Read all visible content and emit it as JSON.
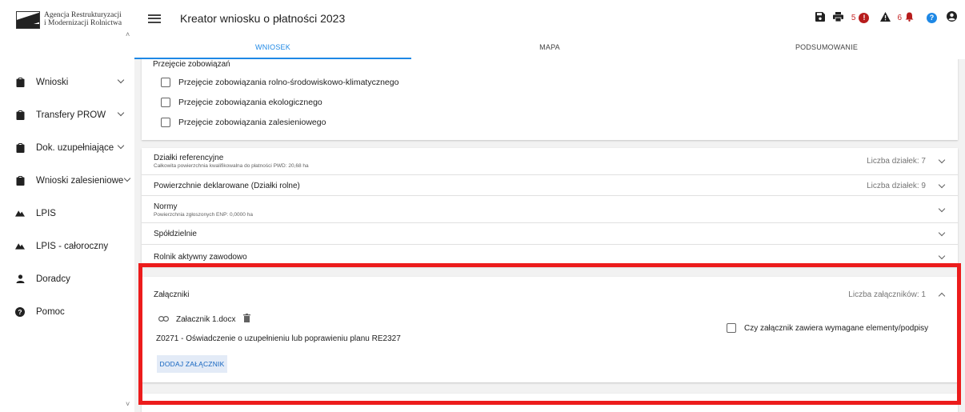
{
  "logo": {
    "line1": "Agencja Restrukturyzacji",
    "line2": "i Modernizacji Rolnictwa"
  },
  "sidebar": {
    "items": [
      {
        "label": "Wnioski",
        "icon": "clipboard-icon",
        "caret": true
      },
      {
        "label": "Transfery PROW",
        "icon": "clipboard-icon",
        "caret": true
      },
      {
        "label": "Dok. uzupełniające",
        "icon": "clipboard-icon",
        "caret": true
      },
      {
        "label": "Wnioski zalesieniowe",
        "icon": "clipboard-icon",
        "caret": true
      },
      {
        "label": "LPIS",
        "icon": "terrain-icon",
        "caret": false
      },
      {
        "label": "LPIS - całoroczny",
        "icon": "terrain-icon",
        "caret": false
      },
      {
        "label": "Doradcy",
        "icon": "person-icon",
        "caret": false
      },
      {
        "label": "Pomoc",
        "icon": "help-icon",
        "caret": false
      }
    ]
  },
  "header": {
    "title": "Kreator wniosku o płatności 2023",
    "errors_count": "5",
    "warnings_count": "6"
  },
  "tabs": [
    {
      "label": "WNIOSEK",
      "active": true
    },
    {
      "label": "MAPA",
      "active": false
    },
    {
      "label": "PODSUMOWANIE",
      "active": false
    }
  ],
  "takeover": {
    "section_title": "Przejęcie zobowiązań",
    "options": [
      "Przejęcie zobowiązania rolno-środowiskowo-klimatycznego",
      "Przejęcie zobowiązania ekologicznego",
      "Przejęcie zobowiązania zalesieniowego"
    ]
  },
  "panels": [
    {
      "title": "Działki referencyjne",
      "subtitle": "Całkowita powierzchnia kwalifikowalna do płatności PWD: 20,68 ha",
      "count": "Liczba działek: 7"
    },
    {
      "title": "Powierzchnie deklarowane (Działki rolne)",
      "subtitle": "",
      "count": "Liczba działek: 9"
    },
    {
      "title": "Normy",
      "subtitle": "Powierzchnia zgłoszonych ENP: 0,0000 ha",
      "count": ""
    },
    {
      "title": "Spółdzielnie",
      "subtitle": "",
      "count": ""
    },
    {
      "title": "Rolnik aktywny zawodowo",
      "subtitle": "",
      "count": ""
    }
  ],
  "attachments": {
    "title": "Załączniki",
    "count": "Liczba załączników: 1",
    "file_name": "Załacznik 1.docx",
    "description": "Z0271 - Oświadczenie o uzupełnieniu lub poprawieniu planu RE2327",
    "checkbox_label": "Czy załącznik zawiera wymagane elementy/podpisy",
    "add_button": "DODAJ ZAŁĄCZNIK"
  },
  "colors": {
    "accent": "#1e88e5",
    "highlight": "#ec1c1c",
    "error": "#b71c1c",
    "help": "#1e88e5"
  }
}
